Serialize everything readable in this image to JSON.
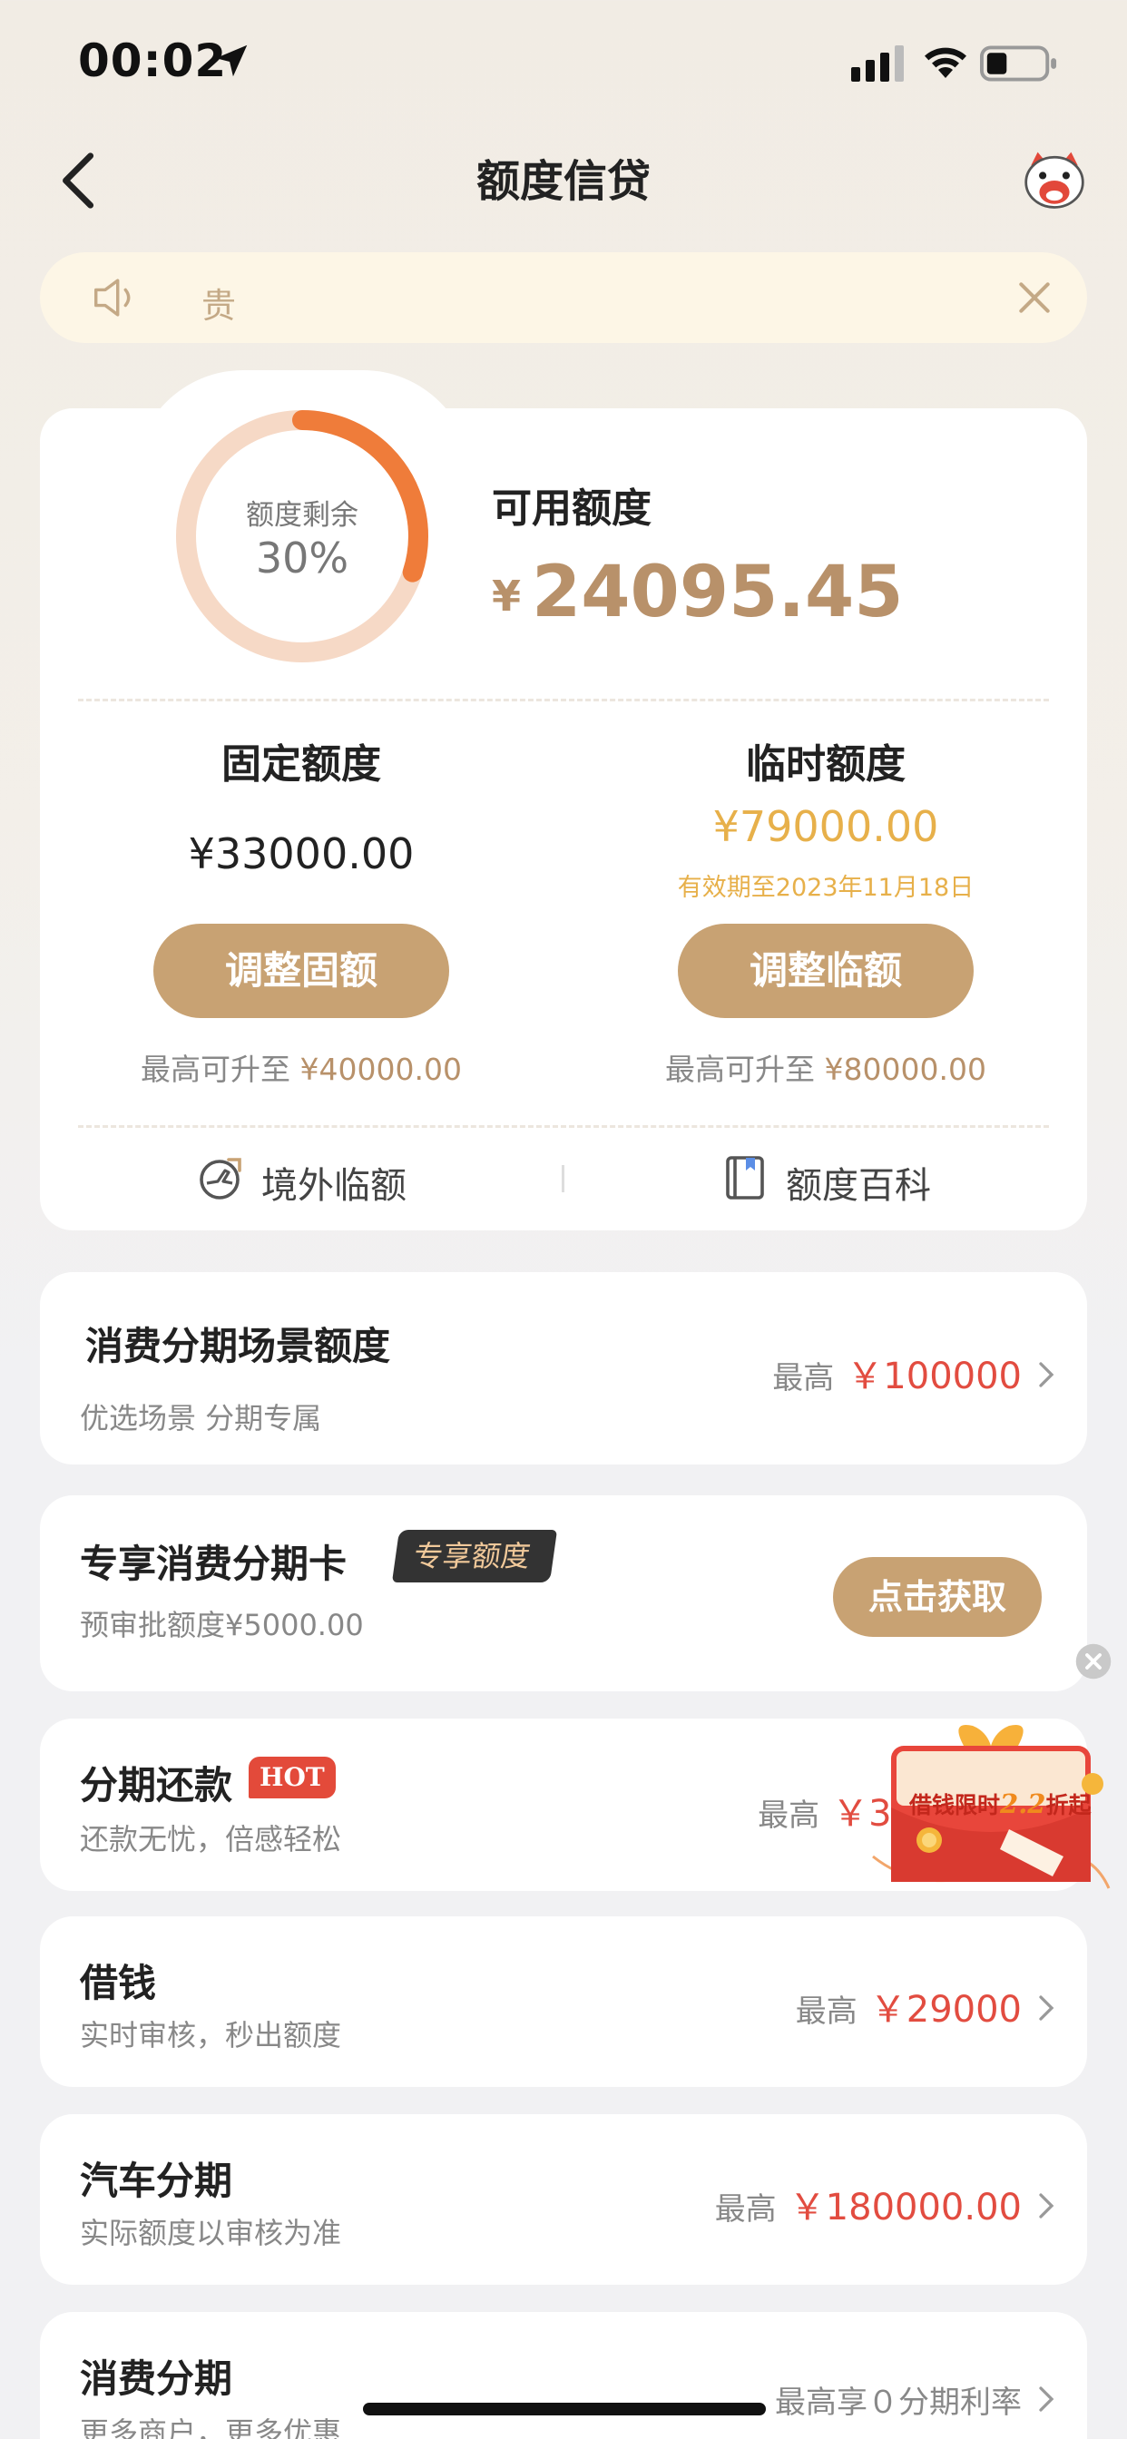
{
  "status_bar": {
    "time": "00:02",
    "icons": [
      "location-arrow-icon",
      "cellular-signal-icon",
      "wifi-icon",
      "battery-icon"
    ]
  },
  "nav": {
    "title": "额度信贷",
    "back_icon": "chevron-left-icon",
    "mascot_icon": "mascot-avatar-icon"
  },
  "notice": {
    "text": "贵",
    "icon": "speaker-icon",
    "close_icon": "close-icon"
  },
  "quota": {
    "ring_label": "额度剩余",
    "ring_percent_text": "30%",
    "ring_percent_value": 0.3,
    "available_title": "可用额度",
    "available_currency": "¥",
    "available_amount": "24095.45",
    "fixed": {
      "title": "固定额度",
      "amount": "¥33000.00",
      "button": "调整固额",
      "max_prefix": "最高可升至",
      "max_value": "¥40000.00"
    },
    "temp": {
      "title": "临时额度",
      "amount": "¥79000.00",
      "valid_until": "有效期至2023年11月18日",
      "button": "调整临额",
      "max_prefix": "最高可升至",
      "max_value": "¥80000.00"
    },
    "links": [
      {
        "label": "境外临额",
        "icon": "globe-plane-icon"
      },
      {
        "label": "额度百科",
        "icon": "book-icon"
      }
    ]
  },
  "cards": {
    "scene": {
      "title": "消费分期场景额度",
      "subtitle": "优选场景 分期专属",
      "prefix": "最高",
      "amount": "￥100000"
    },
    "exclusive": {
      "title": "专享消费分期卡",
      "tag": "专享额度",
      "subtitle": "预审批额度¥5000.00",
      "button": "点击获取"
    },
    "installment": {
      "title": "分期还款",
      "tag": "HOT",
      "subtitle": "还款无忧，倍感轻松",
      "prefix": "最高",
      "amount": "￥39"
    },
    "borrow": {
      "title": "借钱",
      "subtitle": "实时审核，秒出额度",
      "prefix": "最高",
      "amount": "￥29000"
    },
    "car": {
      "title": "汽车分期",
      "subtitle": "实际额度以审核为准",
      "prefix": "最高",
      "amount": "￥180000.00"
    },
    "consumer": {
      "title": "消费分期",
      "subtitle": "更多商户，更多优惠",
      "right_text": "最高享０分期利率"
    }
  },
  "promo": {
    "text_before": "借钱限时",
    "highlight": "2.2",
    "text_after": "折起",
    "close_icon": "close-circle-icon"
  },
  "colors": {
    "accent_gold": "#c8a273",
    "amount_gold": "#b8916a",
    "ring_orange": "#ef7c3a",
    "ring_track": "#f6d9c6",
    "price_red": "#e24c40",
    "temp_yellow": "#e7b04a"
  }
}
